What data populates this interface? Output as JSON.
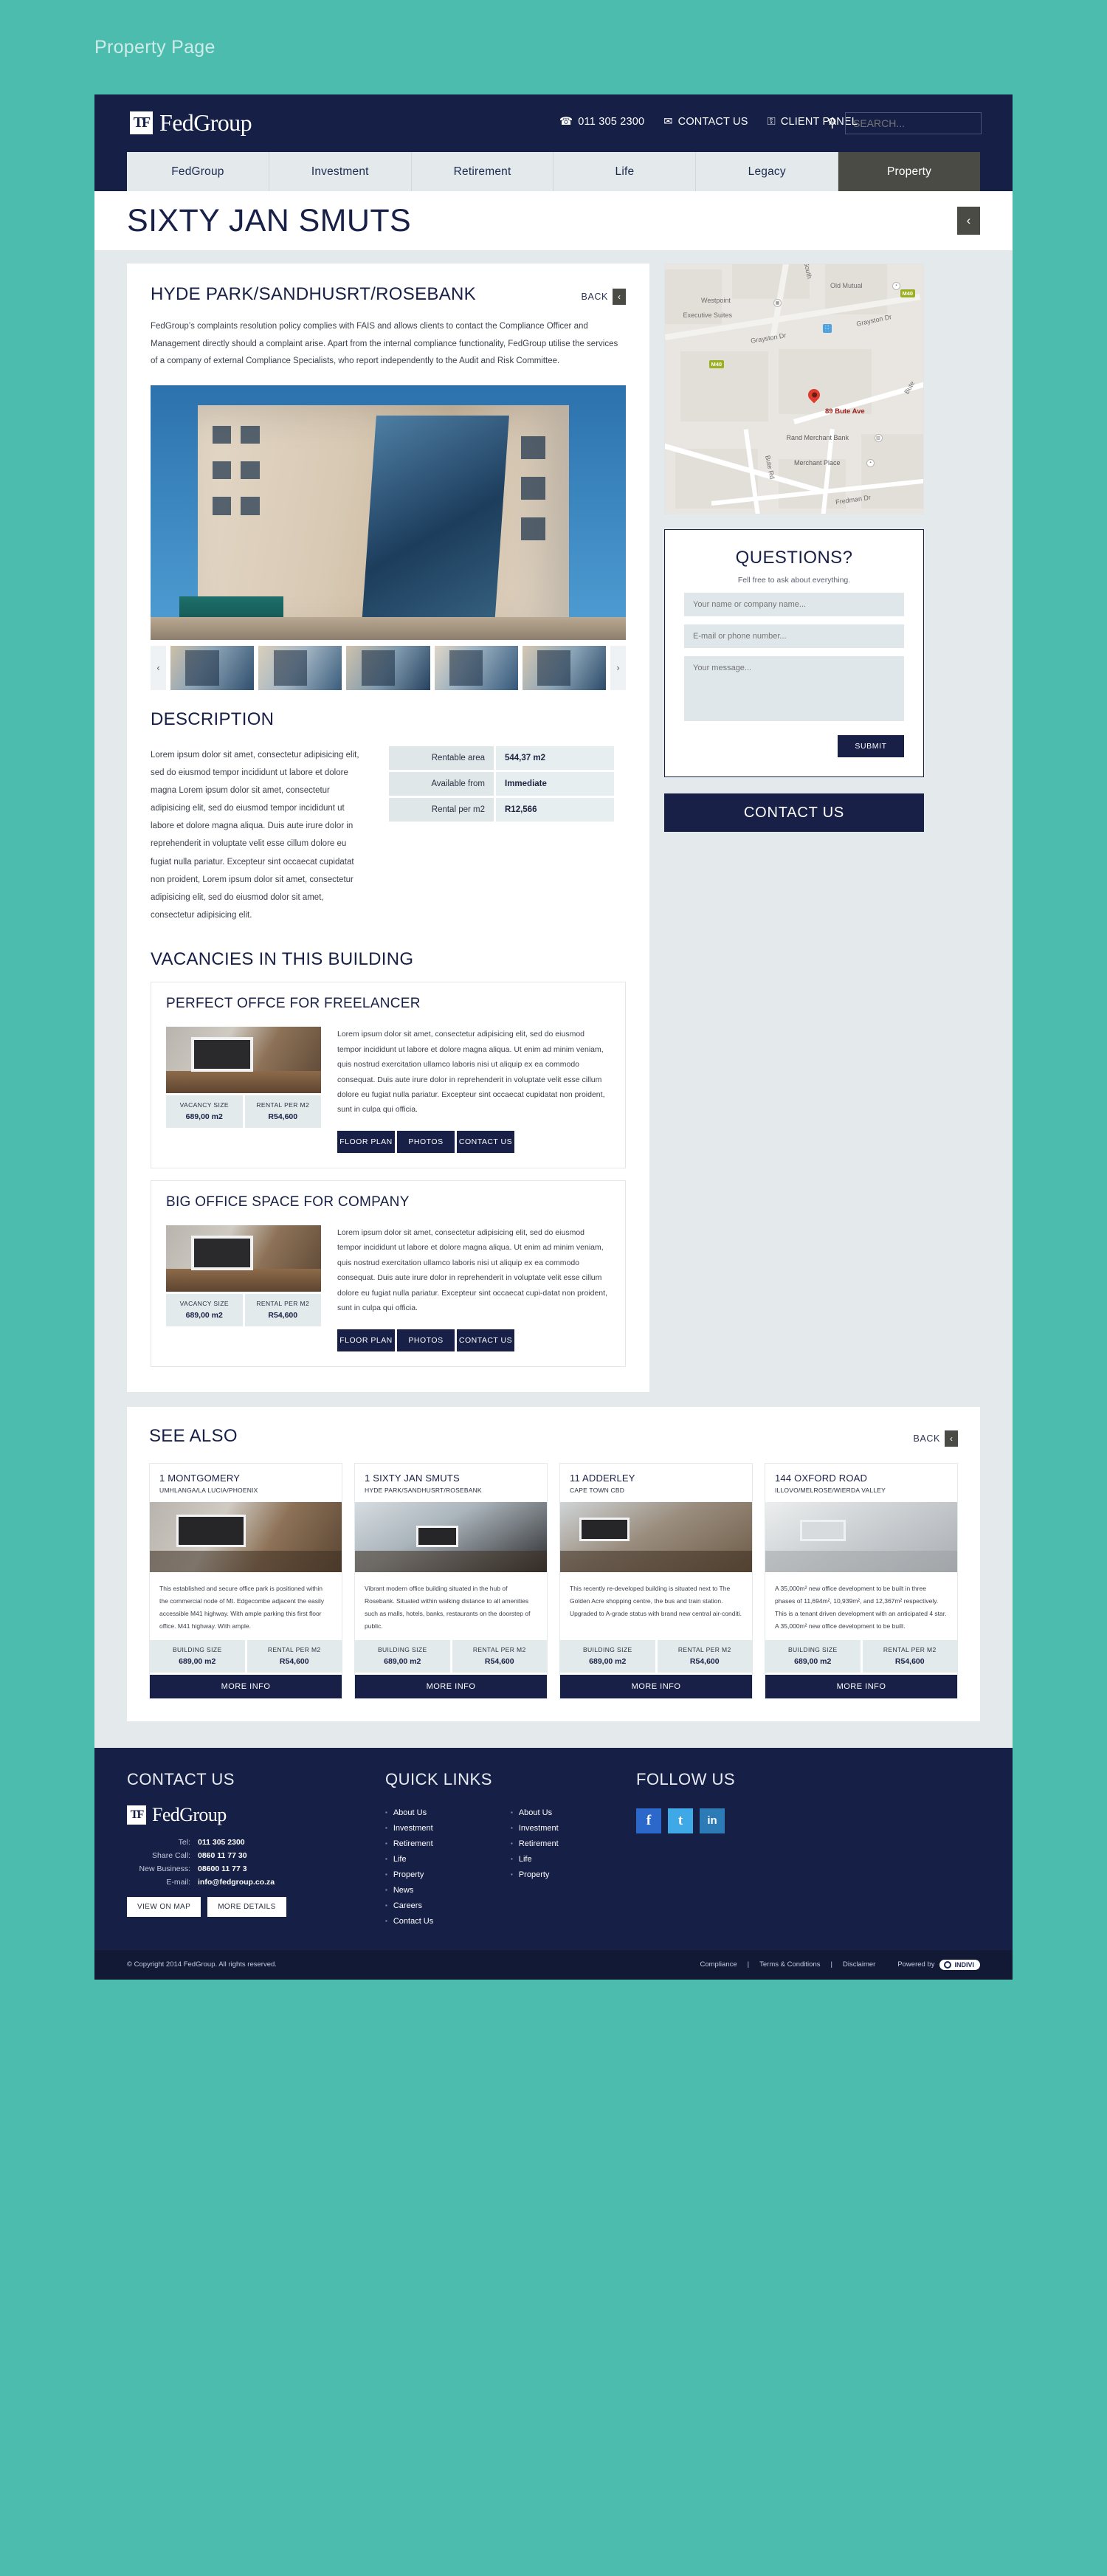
{
  "page_label": "Property Page",
  "brand": {
    "logo_text": "FedGroup",
    "logo_mark": "TF",
    "navy": "#161f45",
    "teal": "#4bbcae"
  },
  "topbar": {
    "phone": "011 305 2300",
    "contact_us": "CONTACT US",
    "client_panel": "CLIENT PANEL",
    "search_placeholder": "SEARCH..."
  },
  "tabs": [
    {
      "label": "FedGroup",
      "active": false
    },
    {
      "label": "Investment",
      "active": false
    },
    {
      "label": "Retirement",
      "active": false
    },
    {
      "label": "Life",
      "active": false
    },
    {
      "label": "Legacy",
      "active": false
    },
    {
      "label": "Property",
      "active": true
    }
  ],
  "title": {
    "text": "SIXTY JAN SMUTS",
    "back_glyph": "‹"
  },
  "main": {
    "heading": "HYDE PARK/SANDHUSRT/ROSEBANK",
    "back_label": "BACK",
    "back_glyph": "‹",
    "intro": "FedGroup’s complaints resolution policy complies with FAIS and allows clients to contact the Compliance Officer and Management directly should a complaint arise. Apart from the internal compliance functionality, FedGroup utilise the services of a company of external Compliance Specialists, who report independently to the Audit and Risk Committee.",
    "thumb_prev": "‹",
    "thumb_next": "›",
    "description_heading": "DESCRIPTION",
    "description_text": "Lorem ipsum dolor sit amet, consectetur adipisicing elit, sed do eiusmod tempor incididunt ut labore et dolore magna Lorem ipsum dolor sit amet, consectetur adipisicing elit, sed do eiusmod tempor incididunt ut labore et dolore magna aliqua. Duis aute irure dolor in reprehenderit in voluptate velit esse cillum dolore eu fugiat nulla pariatur. Excepteur sint occaecat cupidatat non proident, Lorem ipsum dolor sit amet, consectetur adipisicing elit, sed do eiusmod dolor sit amet, consectetur adipisicing elit.",
    "specs": [
      {
        "key": "Rentable area",
        "value": "544,37 m2"
      },
      {
        "key": "Available from",
        "value": "Immediate"
      },
      {
        "key": "Rental per m2",
        "value": "R12,566"
      }
    ],
    "vacancies_heading": "VACANCIES IN THIS BUILDING",
    "vacancies": [
      {
        "title": "PERFECT OFFCE FOR FREELANCER",
        "text": "Lorem ipsum dolor sit amet, consectetur adipisicing elit, sed do eiusmod tempor incididunt ut labore et dolore magna aliqua. Ut enim ad minim veniam, quis nostrud exercitation ullamco laboris nisi ut aliquip ex ea commodo consequat. Duis aute irure dolor in reprehenderit in voluptate velit esse cillum dolore eu fugiat nulla pariatur. Excepteur sint occaecat cupidatat non proident, sunt in culpa qui officia.",
        "size_label": "VACANCY SIZE",
        "size_value": "689,00 m2",
        "rent_label": "RENTAL PER M2",
        "rent_value": "R54,600",
        "btn1": "FLOOR PLAN",
        "btn2": "PHOTOS",
        "btn3": "CONTACT US"
      },
      {
        "title": "BIG OFFICE SPACE FOR COMPANY",
        "text": "Lorem ipsum dolor sit amet, consectetur adipisicing elit, sed do eiusmod tempor incididunt ut labore et dolore magna aliqua. Ut enim ad minim veniam, quis nostrud exercitation ullamco laboris nisi ut aliquip ex ea commodo consequat. Duis aute irure dolor in reprehenderit in voluptate velit esse cillum dolore eu fugiat nulla pariatur. Excepteur sint occaecat cupi-datat non proident, sunt in culpa qui officia.",
        "size_label": "VACANCY SIZE",
        "size_value": "689,00 m2",
        "rent_label": "RENTAL PER M2",
        "rent_value": "R54,600",
        "btn1": "FLOOR PLAN",
        "btn2": "PHOTOS",
        "btn3": "CONTACT US"
      }
    ]
  },
  "map": {
    "pin_label": "89 Bute Ave",
    "labels": [
      "Old Mutual",
      "Westpoint",
      "Executive Suites",
      "Grayston Dr",
      "Grayston Dr",
      "South",
      "Rand Merchant Bank",
      "Merchant Place",
      "Bute Rd",
      "Fredman Dr",
      "Bute"
    ],
    "highway_shield": "M40"
  },
  "questions": {
    "title": "QUESTIONS?",
    "subtitle": "Fell free to ask about everything.",
    "name_placeholder": "Your name or company name...",
    "email_placeholder": "E-mail or phone number...",
    "message_placeholder": "Your message...",
    "submit": "SUBMIT"
  },
  "contact_banner": "CONTACT US",
  "see_also": {
    "heading": "SEE ALSO",
    "back_label": "BACK",
    "back_glyph": "‹",
    "cards": [
      {
        "name": "1 MONTGOMERY",
        "location": "UMHLANGA/LA LUCIA/PHOENIX",
        "text": "This established and secure office park is positioned within the commercial node of Mt. Edgecombe adjacent the easily accessible M41 highway. With ample parking this first floor office. M41 highway. With ample.",
        "size_label": "BUILDING SIZE",
        "size_value": "689,00 m2",
        "rent_label": "RENTAL PER M2",
        "rent_value": "R54,600",
        "more": "MORE INFO"
      },
      {
        "name": "1 SIXTY JAN SMUTS",
        "location": "HYDE PARK/SANDHUSRT/ROSEBANK",
        "text": "Vibrant modern office building situated in the hub of Rosebank. Situated within walking distance to all amenities such as malls, hotels, banks, restaurants on the doorstep of public.",
        "size_label": "BUILDING SIZE",
        "size_value": "689,00 m2",
        "rent_label": "RENTAL PER M2",
        "rent_value": "R54,600",
        "more": "MORE INFO"
      },
      {
        "name": "11 ADDERLEY",
        "location": "CAPE TOWN CBD",
        "text": "This recently re-developed building is situated next to The Golden Acre shopping centre, the bus and train station. Upgraded to A-grade status with brand new central air-conditi.",
        "size_label": "BUILDING SIZE",
        "size_value": "689,00 m2",
        "rent_label": "RENTAL PER M2",
        "rent_value": "R54,600",
        "more": "MORE INFO"
      },
      {
        "name": "144 OXFORD ROAD",
        "location": "ILLOVO/MELROSE/WIERDA VALLEY",
        "text": "A 35,000m² new office development to be built in three phases of 11,694m², 10,939m², and 12,367m² respectively. This is a tenant driven development with an anticipated 4 star. A 35,000m² new office development to be built.",
        "size_label": "BUILDING SIZE",
        "size_value": "689,00 m2",
        "rent_label": "RENTAL PER M2",
        "rent_value": "R54,600",
        "more": "MORE INFO"
      }
    ]
  },
  "footer": {
    "contact_heading": "CONTACT US",
    "contact_rows": [
      {
        "label": "Tel:",
        "value": "011 305 2300"
      },
      {
        "label": "Share Call:",
        "value": "0860 11 77 30"
      },
      {
        "label": "New Business:",
        "value": "08600 11 77 3"
      },
      {
        "label": "E-mail:",
        "value": "info@fedgroup.co.za"
      }
    ],
    "btn_map": "VIEW ON MAP",
    "btn_details": "MORE DETAILS",
    "quick_heading": "QUICK LINKS",
    "quick_links_1": [
      "About Us",
      "Investment",
      "Retirement",
      "Life",
      "Property",
      "News",
      "Careers",
      "Contact Us"
    ],
    "quick_links_2": [
      "About Us",
      "Investment",
      "Retirement",
      "Life",
      "Property"
    ],
    "follow_heading": "FOLLOW US",
    "socials": [
      {
        "name": "facebook",
        "glyph": "f"
      },
      {
        "name": "twitter",
        "glyph": "t"
      },
      {
        "name": "linkedin",
        "glyph": "in"
      }
    ],
    "copyright": "© Copyright 2014 FedGroup. All rights reserved.",
    "legal": [
      "Compliance",
      "Terms & Conditions",
      "Disclaimer"
    ],
    "powered_by": "Powered by",
    "vendor": "INDIVI"
  }
}
